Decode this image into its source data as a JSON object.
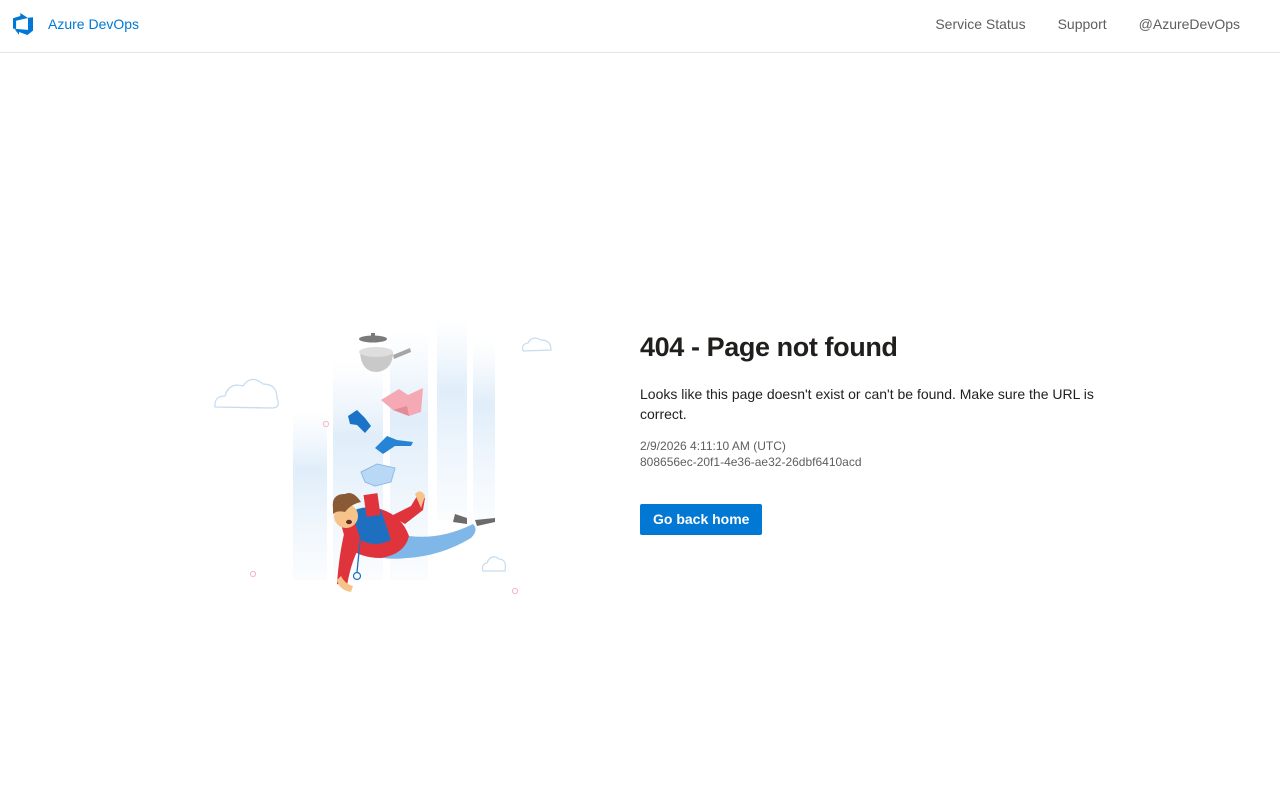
{
  "header": {
    "brand": "Azure DevOps",
    "brand_icon": "azure-devops-logo-icon",
    "nav": [
      {
        "label": "Service Status"
      },
      {
        "label": "Support"
      },
      {
        "label": "@AzureDevOps"
      }
    ]
  },
  "error": {
    "title": "404 - Page not found",
    "message": "Looks like this page doesn't exist or can't be found. Make sure the URL is correct.",
    "timestamp": "2/9/2026 4:11:10 AM (UTC)",
    "activity_id": "808656ec-20f1-4e36-ae32-26dbf6410acd",
    "button_label": "Go back home"
  },
  "colors": {
    "accent": "#0078d4",
    "nav_text": "#605e5c",
    "title_text": "#201f1e"
  }
}
